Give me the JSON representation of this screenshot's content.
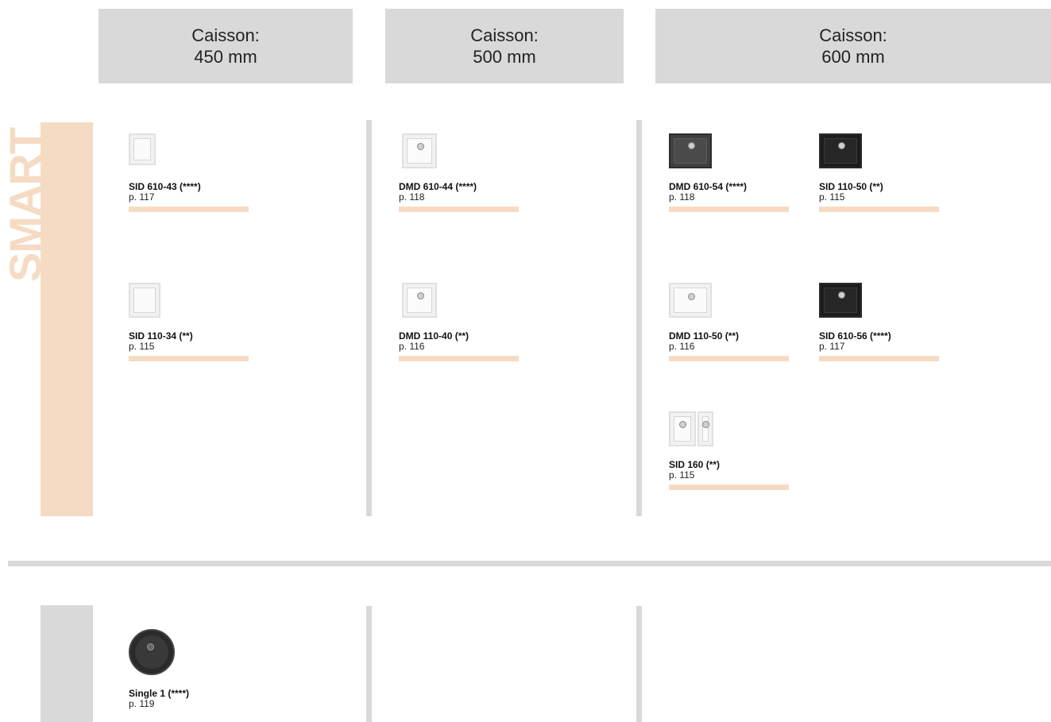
{
  "headers": [
    {
      "line1": "Caisson:",
      "line2": "450 mm"
    },
    {
      "line1": "Caisson:",
      "line2": "500 mm"
    },
    {
      "line1": "Caisson:",
      "line2": "600 mm"
    }
  ],
  "band_label": "SMART",
  "products": [
    {
      "name": "SID 610-43 (****)",
      "page": "p. 117",
      "icon": "white-sink-icon"
    },
    {
      "name": "SID 110-34 (**)",
      "page": "p. 115",
      "icon": "white-sink-icon"
    },
    {
      "name": "DMD 610-44 (****)",
      "page": "p. 118",
      "icon": "white-sink-icon"
    },
    {
      "name": "DMD 110-40 (**)",
      "page": "p. 116",
      "icon": "white-sink-icon"
    },
    {
      "name": "DMD 610-54 (****)",
      "page": "p. 118",
      "icon": "grey-sink-icon"
    },
    {
      "name": "SID 110-50 (**)",
      "page": "p. 115",
      "icon": "black-sink-icon"
    },
    {
      "name": "DMD 110-50 (**)",
      "page": "p. 116",
      "icon": "white-sink-icon"
    },
    {
      "name": "SID 610-56 (****)",
      "page": "p. 117",
      "icon": "black-sink-icon"
    },
    {
      "name": "SID 160 (**)",
      "page": "p. 115",
      "icon": "white-double-sink-icon"
    },
    {
      "name": "Single 1 (****)",
      "page": "p. 119",
      "icon": "black-round-sink-icon"
    }
  ],
  "colors": {
    "accent": "#f6dbc4",
    "header_bg": "#d9d9d9"
  }
}
